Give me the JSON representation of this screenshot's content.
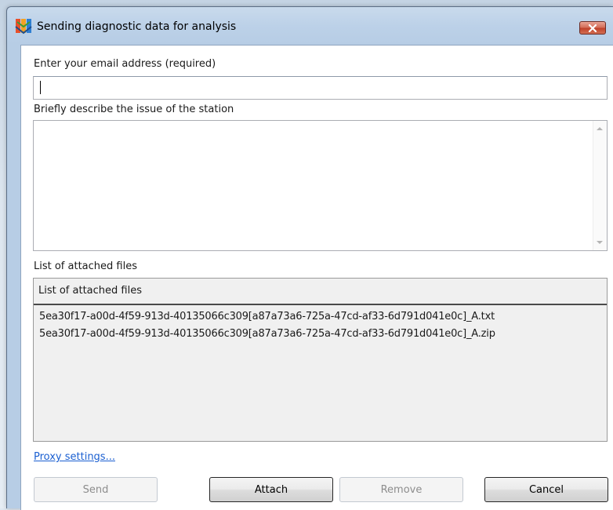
{
  "window": {
    "title": "Sending diagnostic data for analysis",
    "icon": "avg-logo-icon",
    "close_icon": "close-icon"
  },
  "email": {
    "label": "Enter your email address (required)",
    "value": "",
    "placeholder": ""
  },
  "description": {
    "label": "Briefly describe the issue of the station",
    "value": ""
  },
  "attachments": {
    "section_label": "List of attached files",
    "column_header": "List of attached files",
    "files": [
      "5ea30f17-a00d-4f59-913d-40135066c309[a87a73a6-725a-47cd-af33-6d791d041e0c]_A.txt",
      "5ea30f17-a00d-4f59-913d-40135066c309[a87a73a6-725a-47cd-af33-6d791d041e0c]_A.zip"
    ]
  },
  "proxy_link": "Proxy settings...",
  "buttons": {
    "send": "Send",
    "attach": "Attach",
    "remove": "Remove",
    "cancel": "Cancel"
  },
  "colors": {
    "link": "#1a5fd1",
    "close_button": "#c0422a",
    "titlebar": "#bcd1e8"
  }
}
